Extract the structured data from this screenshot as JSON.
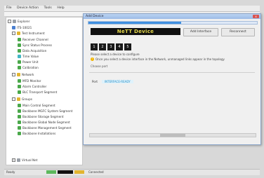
{
  "menubar": {
    "items": [
      "File",
      "Device Action",
      "Tools",
      "Help"
    ]
  },
  "tree": {
    "root_label": "Explorer",
    "items": [
      {
        "label": "ITS-10021",
        "icon": "server-icon",
        "color": "#4a7fd0"
      },
      {
        "label": "Test Instrument",
        "icon": "folder-icon",
        "color": "#e2b530"
      },
      {
        "label": "Receiver Channel",
        "icon": "device-icon",
        "color": "#4aa84a"
      },
      {
        "label": "Sync Status Process",
        "icon": "device-icon",
        "color": "#4aa84a"
      },
      {
        "label": "Data Acquisition",
        "icon": "device-icon",
        "color": "#4aa84a"
      },
      {
        "label": "Time Value",
        "icon": "clock-icon",
        "color": "#41b6c4"
      },
      {
        "label": "Power Unit",
        "icon": "device-icon",
        "color": "#4aa84a"
      },
      {
        "label": "Calibration",
        "icon": "device-icon",
        "color": "#4aa84a"
      },
      {
        "label": "Network",
        "icon": "folder-icon",
        "color": "#e2b530"
      },
      {
        "label": "MFD Monitor",
        "icon": "device-icon",
        "color": "#4aa84a"
      },
      {
        "label": "Alarm Controller",
        "icon": "device-icon",
        "color": "#4aa84a"
      },
      {
        "label": "BLC Transport Segment",
        "icon": "device-icon",
        "color": "#4aa84a"
      },
      {
        "label": "Groups",
        "icon": "folder-icon",
        "color": "#e2b530"
      },
      {
        "label": "Main Control Segment",
        "icon": "device-icon",
        "color": "#4aa84a"
      },
      {
        "label": "Backbone MGFC System Segment",
        "icon": "device-icon",
        "color": "#4aa84a"
      },
      {
        "label": "Backbone Storage Segment",
        "icon": "device-icon",
        "color": "#4aa84a"
      },
      {
        "label": "Backbone Global Node Segment",
        "icon": "device-icon",
        "color": "#4aa84a"
      },
      {
        "label": "Backbone Management Segment",
        "icon": "device-icon",
        "color": "#4aa84a"
      },
      {
        "label": "Backbone Installations",
        "icon": "device-icon",
        "color": "#4aa84a"
      },
      {
        "label": "Virtual Net",
        "icon": "folder-icon",
        "color": "#9aa0a8"
      }
    ]
  },
  "window": {
    "title": "Add Device",
    "progress_fraction": 0.55,
    "banner": "NeTT Device",
    "buttons": [
      "Add Interface",
      "Reconnect"
    ],
    "keys": [
      "1",
      "2",
      "3",
      "4",
      "5"
    ],
    "hint1": "Please select a device to configure",
    "warning": "Once you select a device interface in the Network, unmanaged links appear in the topology",
    "hint2": "Choose port",
    "row_label": "Port",
    "row_value": "INTERFACE-READY",
    "close_label": "x"
  },
  "status": {
    "left": "Ready",
    "mid": "Connected",
    "right": ""
  }
}
